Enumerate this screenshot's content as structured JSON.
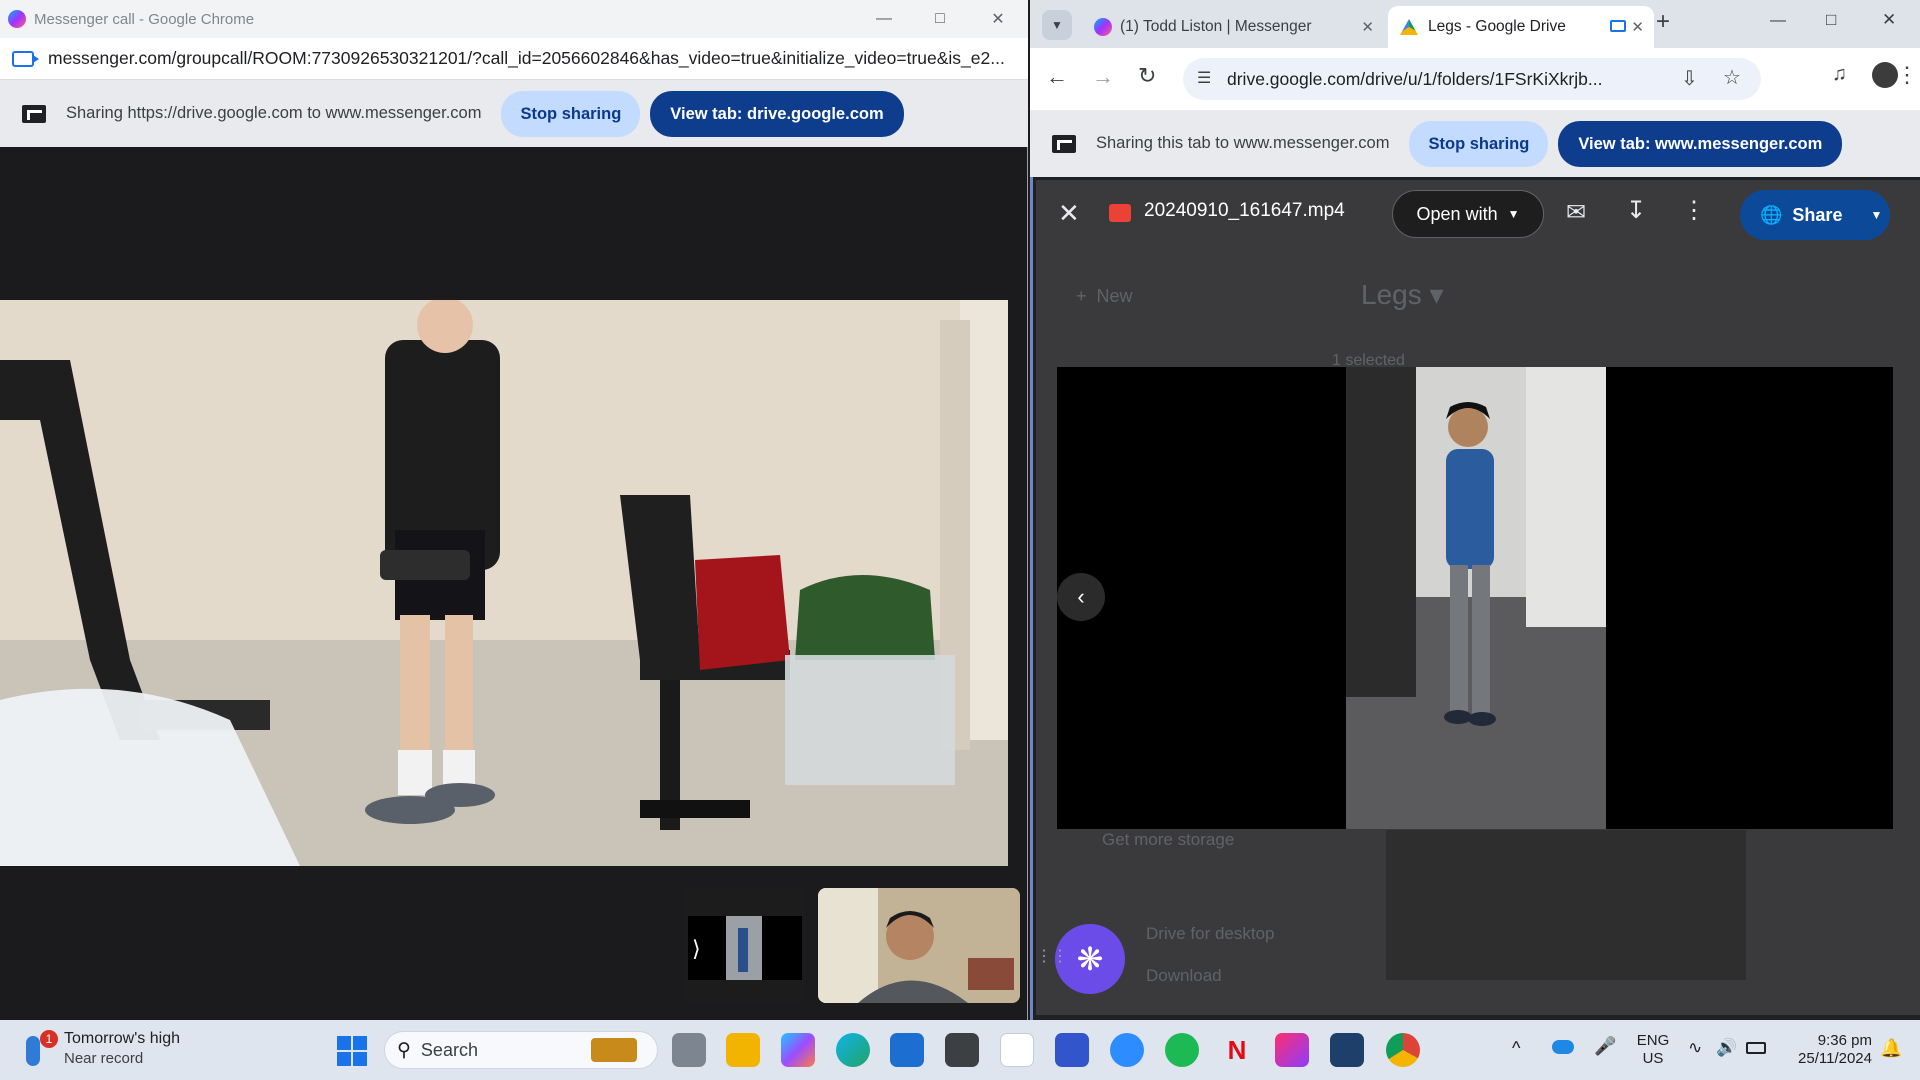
{
  "left_window": {
    "title": "Messenger call - Google Chrome",
    "url": "messenger.com/groupcall/ROOM:7730926530321201/?call_id=2056602846&has_video=true&initialize_video=true&is_e2...",
    "share_text": "Sharing https://drive.google.com to www.messenger.com",
    "stop_sharing": "Stop sharing",
    "view_tab": "View tab: drive.google.com"
  },
  "right_window": {
    "tabs": [
      {
        "label": "(1) Todd Liston | Messenger"
      },
      {
        "label": "Legs - Google Drive"
      }
    ],
    "new_tab": "+",
    "url": "drive.google.com/drive/u/1/folders/1FSrKiXkrjb...",
    "share_text": "Sharing this tab to www.messenger.com",
    "stop_sharing": "Stop sharing",
    "view_tab": "View tab: www.messenger.com"
  },
  "drive": {
    "file_name": "20240910_161647.mp4",
    "open_with": "Open with",
    "share": "Share",
    "background_new": "New",
    "background_folder": "Legs",
    "background_selected": "1 selected",
    "background_storage": "Get more storage",
    "background_desktop": "Drive for desktop",
    "background_download": "Download"
  },
  "taskbar": {
    "weather_title": "Tomorrow's high",
    "weather_sub": "Near record",
    "weather_badge": "1",
    "search": "Search",
    "lang_top": "ENG",
    "lang_bottom": "US",
    "time": "9:36 pm",
    "date": "25/11/2024"
  },
  "colors": {
    "accent_blue": "#0d3d8c",
    "light_pill": "#c2dbff",
    "fab_purple": "#6c4ce8"
  }
}
